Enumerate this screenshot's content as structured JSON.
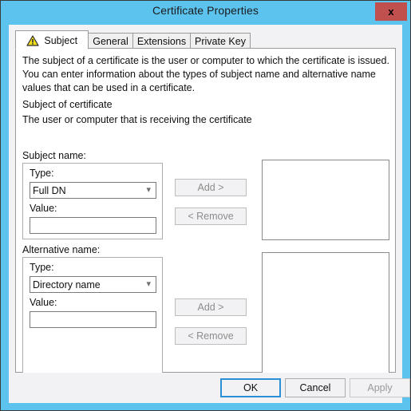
{
  "window": {
    "title": "Certificate Properties",
    "close_label": "x",
    "frame_color": "#5cc3ef",
    "close_color": "#c0504d"
  },
  "tabs": [
    {
      "label": "Subject",
      "icon": "warning-triangle-icon",
      "active": true
    },
    {
      "label": "General",
      "icon": null,
      "active": false
    },
    {
      "label": "Extensions",
      "icon": null,
      "active": false
    },
    {
      "label": "Private Key",
      "icon": null,
      "active": false
    }
  ],
  "panel": {
    "description": "The subject of a certificate is the user or computer to which the certificate is issued. You can enter information about the types of subject name and alternative name values that can be used in a certificate.",
    "section_title": "Subject of certificate",
    "section_text": "The user or computer that is receiving the certificate"
  },
  "subject_name": {
    "group_label": "Subject name:",
    "type_label": "Type:",
    "type_value": "Full DN",
    "type_options": [
      "Full DN"
    ],
    "value_label": "Value:",
    "value_text": "",
    "add_label": "Add >",
    "remove_label": "< Remove",
    "add_enabled": false,
    "remove_enabled": false,
    "list_items": []
  },
  "alternative_name": {
    "group_label": "Alternative name:",
    "type_label": "Type:",
    "type_value": "Directory name",
    "type_options": [
      "Directory name"
    ],
    "value_label": "Value:",
    "value_text": "",
    "add_label": "Add >",
    "remove_label": "< Remove",
    "add_enabled": false,
    "remove_enabled": false,
    "list_items": []
  },
  "footer": {
    "ok_label": "OK",
    "cancel_label": "Cancel",
    "apply_label": "Apply",
    "apply_enabled": false
  }
}
